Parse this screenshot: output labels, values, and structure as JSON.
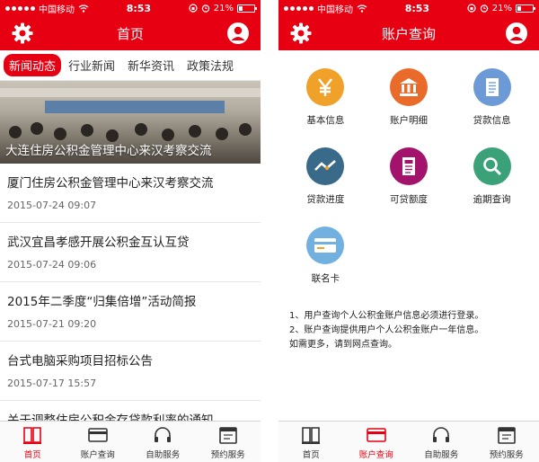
{
  "status_bar": {
    "carrier": "中国移动",
    "time": "8:53",
    "battery": "21%"
  },
  "left": {
    "title": "首页",
    "tabs": [
      {
        "label": "新闻动态",
        "active": true
      },
      {
        "label": "行业新闻",
        "active": false
      },
      {
        "label": "新华资讯",
        "active": false
      },
      {
        "label": "政策法规",
        "active": false
      }
    ],
    "hero_caption": "大连住房公积金管理中心来汉考察交流",
    "news": [
      {
        "title": "厦门住房公积金管理中心来汉考察交流",
        "date": "2015-07-24 09:07"
      },
      {
        "title": "武汉宜昌孝感开展公积金互认互贷",
        "date": "2015-07-24 09:06"
      },
      {
        "title": "2015年二季度“归集倍增”活动简报",
        "date": "2015-07-21 09:20"
      },
      {
        "title": "台式电脑采购项目招标公告",
        "date": "2015-07-17 15:57"
      },
      {
        "title": "关于调整住房公积金存贷款利率的通知",
        "date": ""
      }
    ]
  },
  "right": {
    "title": "账户查询",
    "grid": [
      {
        "label": "基本信息",
        "icon": "yen-icon",
        "color": "#f0a12a"
      },
      {
        "label": "账户明细",
        "icon": "bank-icon",
        "color": "#ea6a2a"
      },
      {
        "label": "贷款信息",
        "icon": "document-icon",
        "color": "#6b9ad6"
      },
      {
        "label": "贷款进度",
        "icon": "trend-icon",
        "color": "#3a6a8a"
      },
      {
        "label": "可贷额度",
        "icon": "form-icon",
        "color": "#a3136b"
      },
      {
        "label": "逾期查询",
        "icon": "magnifier-icon",
        "color": "#3aa178"
      },
      {
        "label": "联名卡",
        "icon": "card-icon",
        "color": "#72b1df"
      }
    ],
    "notes": [
      "1、用户查询个人公积金账户信息必须进行登录。",
      "2、账户查询提供用户个人公积金账户一年信息。",
      "如需更多，请到网点查询。"
    ]
  },
  "tabbar": {
    "items": [
      {
        "label": "首页"
      },
      {
        "label": "账户查询"
      },
      {
        "label": "自助服务"
      },
      {
        "label": "预约服务"
      }
    ]
  },
  "colors": {
    "brand_red": "#e60012"
  }
}
